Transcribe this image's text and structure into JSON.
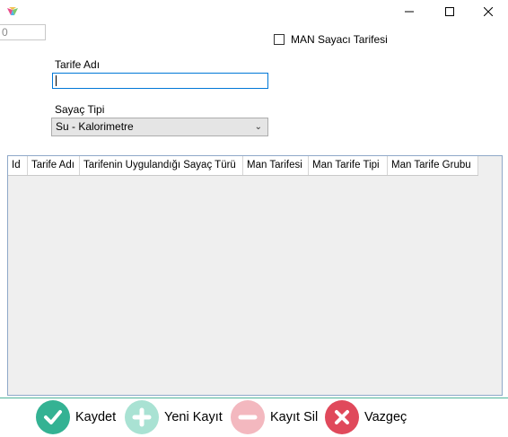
{
  "titlebar": {
    "icon": "app-icon",
    "minimize": "minimize-icon",
    "maximize": "maximize-icon",
    "close": "close-icon"
  },
  "form": {
    "id_value": "0",
    "man_checkbox_label": "MAN Sayacı Tarifesi",
    "man_checked": false,
    "tarife_adi_label": "Tarife Adı",
    "tarife_adi_value": "",
    "sayac_tipi_label": "Sayaç Tipi",
    "sayac_tipi_value": "Su - Kalorimetre"
  },
  "grid": {
    "columns": [
      "Id",
      "Tarife Adı",
      "Tarifenin Uygulandığı Sayaç Türü",
      "Man Tarifesi",
      "Man Tarife Tipi",
      "Man Tarife Grubu"
    ],
    "rows": []
  },
  "actions": {
    "save_label": "Kaydet",
    "new_label": "Yeni Kayıt",
    "delete_label": "Kayıt Sil",
    "cancel_label": "Vazgeç"
  },
  "colors": {
    "save": "#34b293",
    "new": "#a9e2d3",
    "delete": "#f3b8bf",
    "cancel": "#e0495b",
    "focus_border": "#0078d7"
  }
}
